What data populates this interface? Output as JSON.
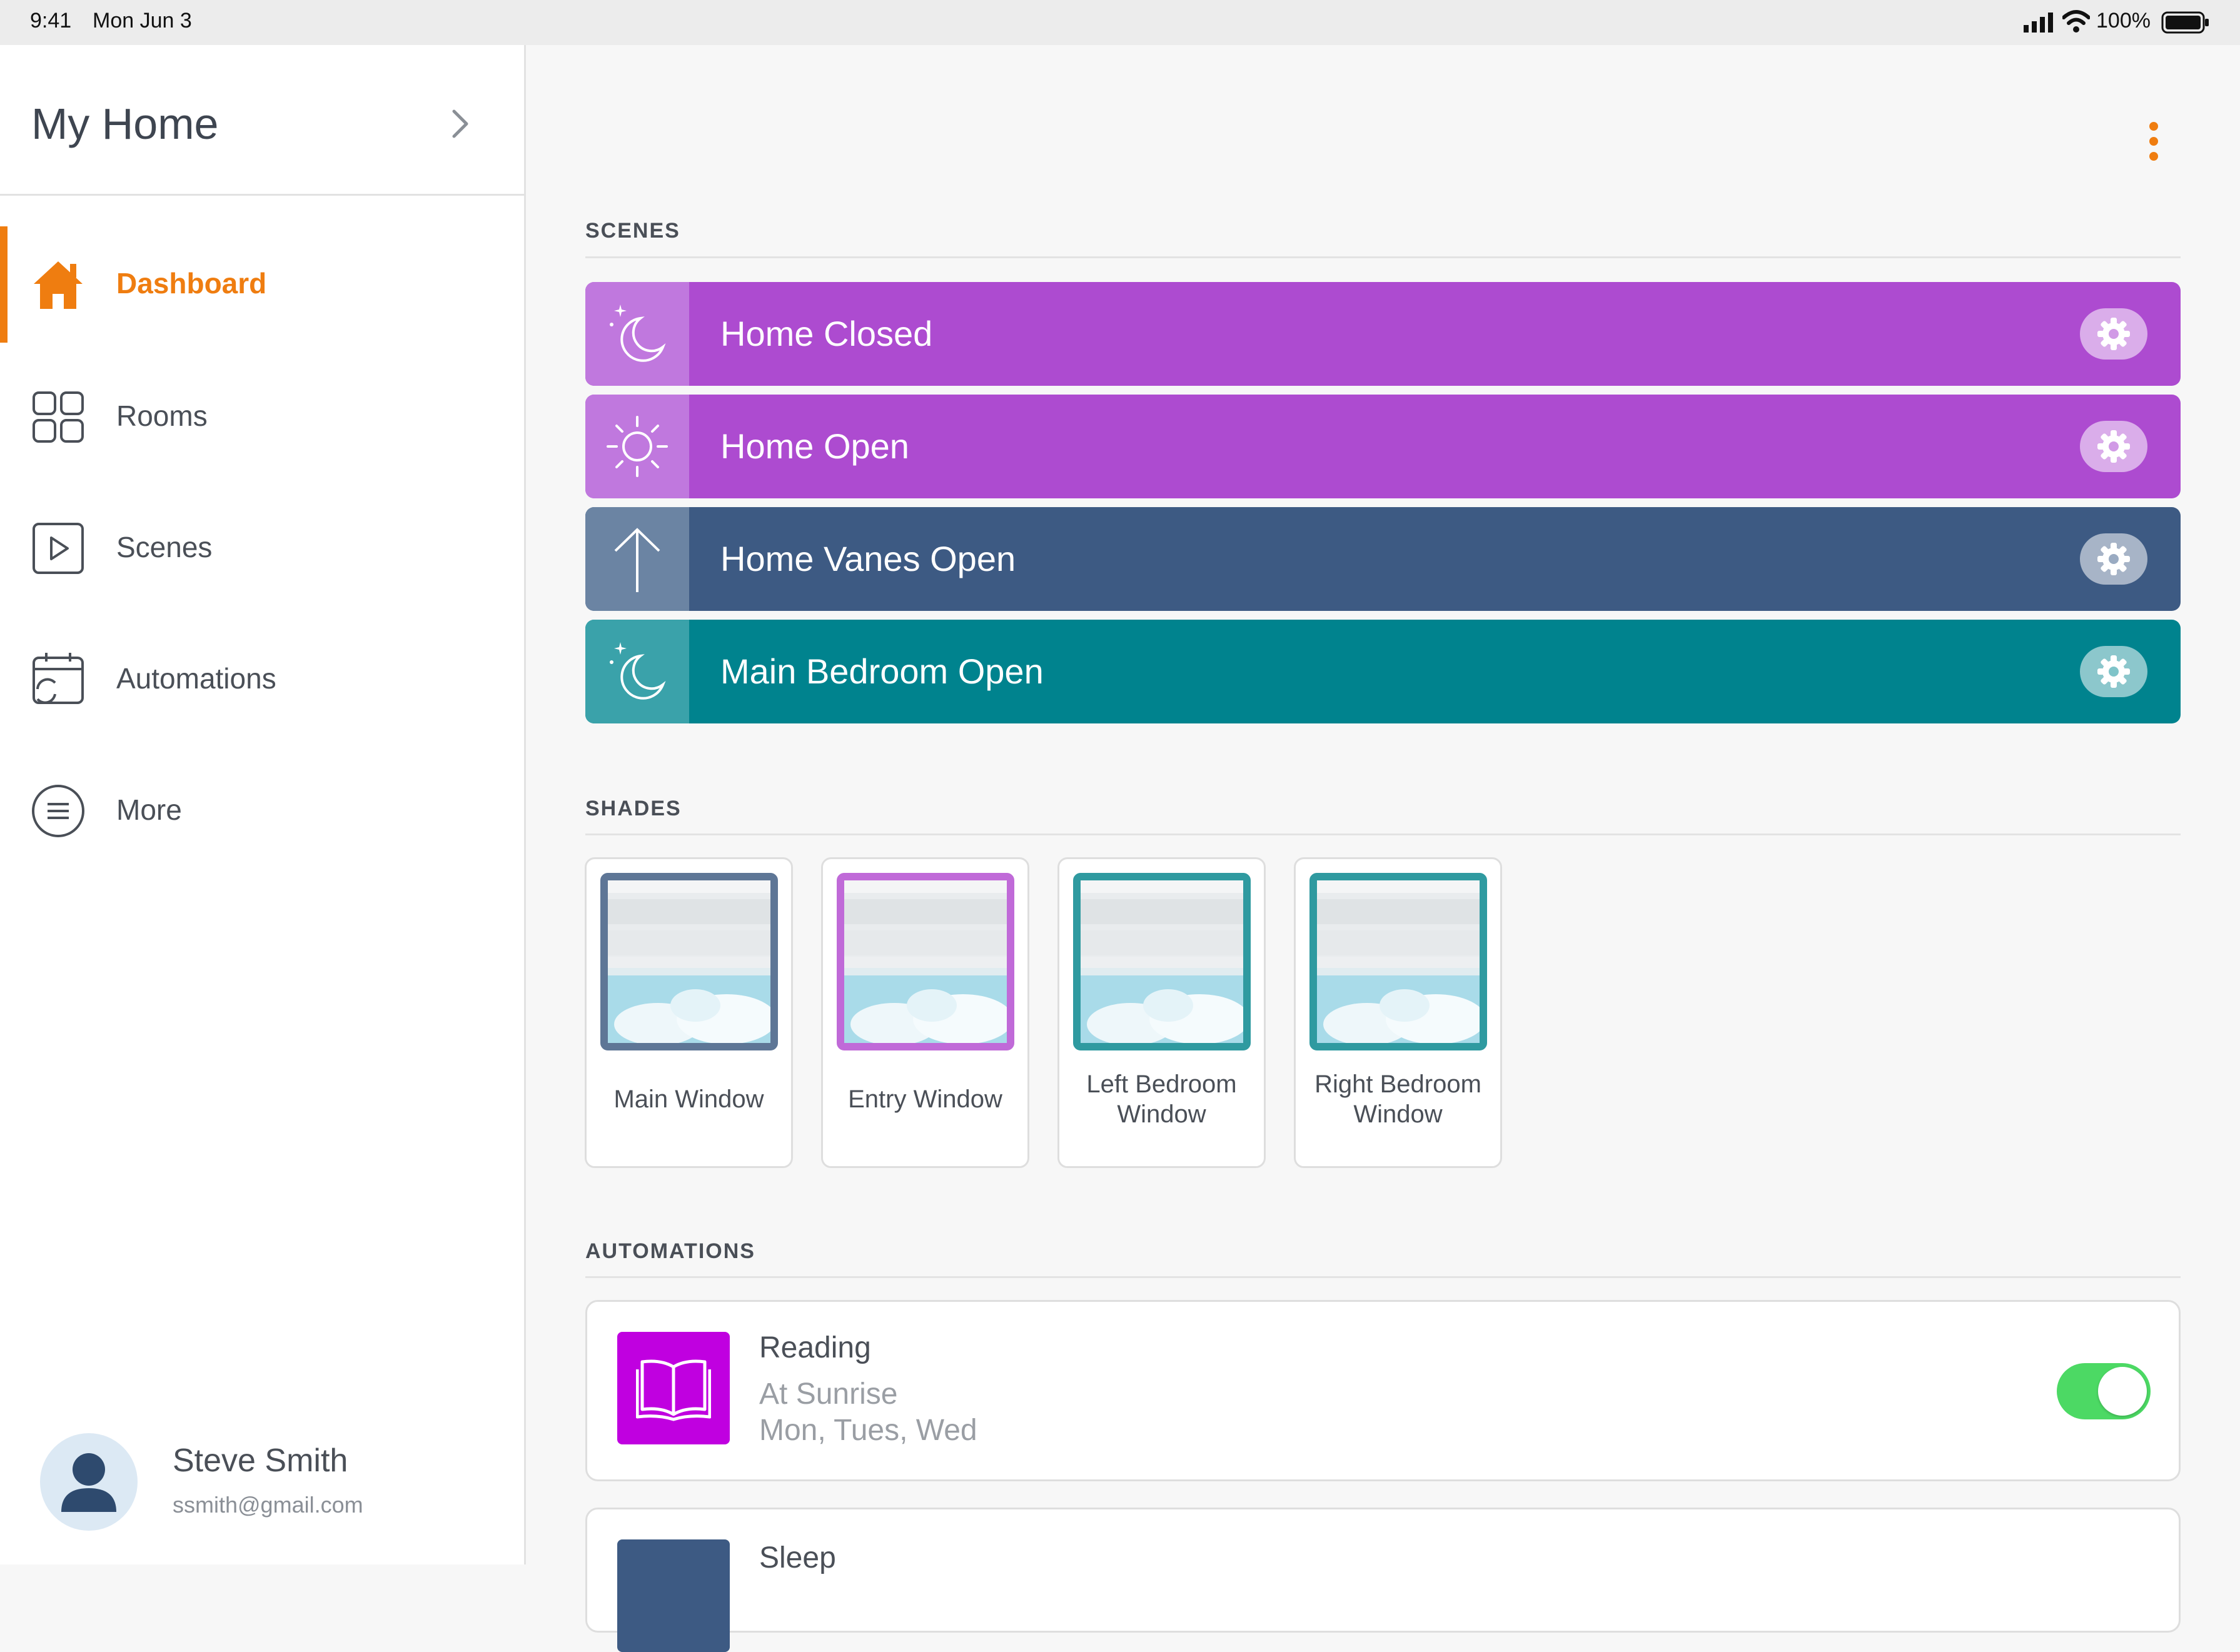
{
  "status_bar": {
    "time": "9:41",
    "date": "Mon Jun 3",
    "battery": "100%",
    "icons": [
      "signal-icon",
      "wifi-icon",
      "battery-icon"
    ]
  },
  "sidebar": {
    "home_title": "My Home",
    "items": [
      {
        "label": "Dashboard",
        "icon": "home-icon",
        "active": true
      },
      {
        "label": "Rooms",
        "icon": "grid-icon",
        "active": false
      },
      {
        "label": "Scenes",
        "icon": "play-icon",
        "active": false
      },
      {
        "label": "Automations",
        "icon": "calendar-sync-icon",
        "active": false
      },
      {
        "label": "More",
        "icon": "menu-circle-icon",
        "active": false
      }
    ],
    "profile": {
      "name": "Steve Smith",
      "email": "ssmith@gmail.com"
    }
  },
  "colors": {
    "accent": "#ef7d10",
    "purple": "#ad4bd0",
    "slate": "#3d5a83",
    "teal": "#00838e",
    "toggle_on": "#4cd964"
  },
  "scenes": {
    "title": "SCENES",
    "items": [
      {
        "label": "Home Closed",
        "icon": "moon-stars-icon",
        "color": "#ad4bd0"
      },
      {
        "label": "Home Open",
        "icon": "sun-icon",
        "color": "#ad4bd0"
      },
      {
        "label": "Home Vanes Open",
        "icon": "arrow-up-icon",
        "color": "#3d5a83"
      },
      {
        "label": "Main Bedroom Open",
        "icon": "moon-stars-icon",
        "color": "#00838e"
      }
    ]
  },
  "shades": {
    "title": "SHADES",
    "items": [
      {
        "line1": "Main Window",
        "line2": "",
        "frame_color": "#5e7696"
      },
      {
        "line1": "Entry Window",
        "line2": "",
        "frame_color": "#c06ad8"
      },
      {
        "line1": "Left Bedroom",
        "line2": "Window",
        "frame_color": "#2f9aa0"
      },
      {
        "line1": "Right Bedroom",
        "line2": "Window",
        "frame_color": "#2f9aa0"
      }
    ]
  },
  "automations": {
    "title": "AUTOMATIONS",
    "items": [
      {
        "title": "Reading",
        "time": "At Sunrise",
        "days": "Mon, Tues, Wed",
        "enabled": true,
        "icon": "book-icon",
        "color": "#c000e0"
      },
      {
        "title": "Sleep",
        "icon": "automation-icon",
        "color": "#3d5a83"
      }
    ]
  }
}
